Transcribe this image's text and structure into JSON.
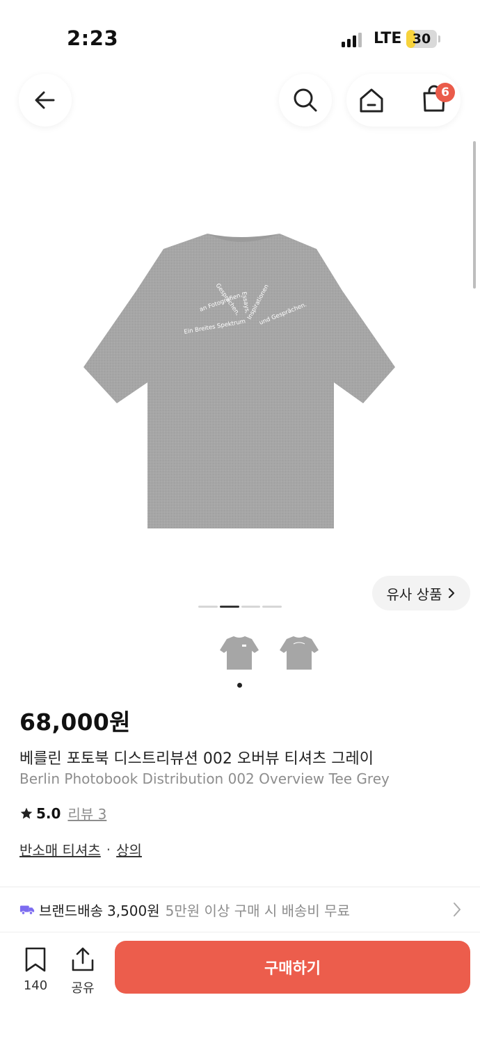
{
  "status_bar": {
    "time": "2:23",
    "network": "LTE",
    "battery": "30",
    "battery_level": 0.3
  },
  "nav": {
    "back_icon": "arrow-left-icon",
    "search_icon": "search-icon",
    "home_icon": "home-icon",
    "cart_icon": "shopping-bag-icon",
    "cart_badge": "6"
  },
  "product": {
    "image_caption_lines": [
      "Gesprächen,",
      "Essays,",
      "Inspirationen",
      "an Fotografien,",
      "Ein Breites Spektrum",
      "und Gesprächen."
    ],
    "similar_label": "유사 상품",
    "carousel": {
      "total": 4,
      "active": 1
    },
    "price": "68,000원",
    "name_ko": "베를린 포토북 디스트리뷰션 002 오버뷰 티셔츠 그레이",
    "name_en": "Berlin Photobook Distribution 002 Overview Tee Grey",
    "rating": "5.0",
    "review_label": "리뷰 3",
    "category": "반소매 티셔츠",
    "category_sep": "·",
    "category_parent": "상의"
  },
  "shipping": {
    "brand_label": "브랜드배송",
    "fee": "3,500원",
    "note": "5만원 이상 구매 시 배송비 무료"
  },
  "bottom_bar": {
    "bookmark_count": "140",
    "share_label": "공유",
    "buy_label": "구매하기"
  },
  "colors": {
    "accent": "#ec5d4c",
    "badge": "#ea5b4a",
    "shipping_truck": "#7c6cf0",
    "tee_grey": "#a5a5a5"
  }
}
